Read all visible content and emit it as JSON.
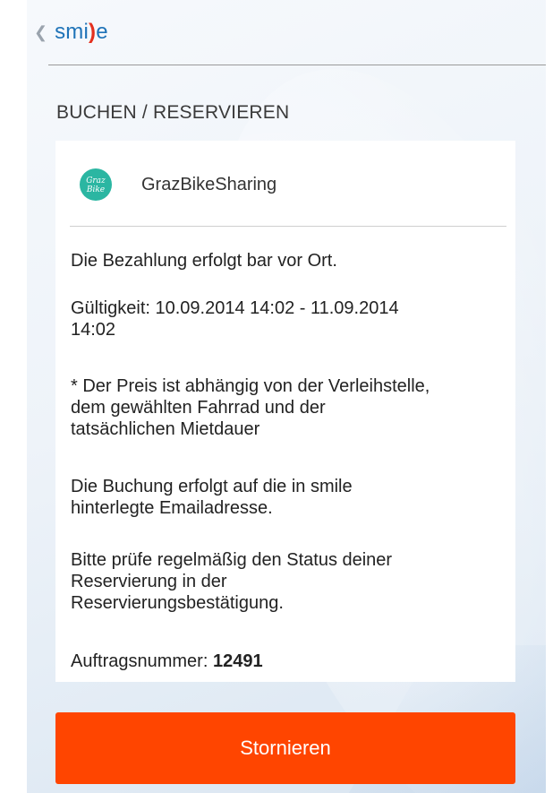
{
  "header": {
    "back_chevron": "❮",
    "logo_part1": "smi",
    "logo_part2": ")",
    "logo_part3": "e"
  },
  "section": {
    "title": "BUCHEN / RESERVIEREN"
  },
  "provider": {
    "name": "GrazBikeSharing",
    "logo_text_line1": "Graz",
    "logo_text_line2": "Bike"
  },
  "info": {
    "payment": "Die Bezahlung erfolgt bar vor Ort.",
    "validity_line1": "Gültigkeit: 10.09.2014 14:02 - 11.09.2014",
    "validity_line2": "14:02",
    "price_line1": "* Der Preis ist abhängig von der Verleihstelle,",
    "price_line2": "dem gewählten Fahrrad und der",
    "price_line3": "tatsächlichen Mietdauer",
    "booking_line1": "Die Buchung erfolgt auf die in smile",
    "booking_line2": "hinterlegte Emailadresse.",
    "check_line1": "Bitte prüfe regelmäßig den Status deiner",
    "check_line2": "Reservierung in der",
    "check_line3": "Reservierungsbestätigung.",
    "order_label": "Auftragsnummer: ",
    "order_number": "12491"
  },
  "actions": {
    "cancel_label": "Stornieren"
  },
  "colors": {
    "accent_button": "#ff4500",
    "logo_blue": "#1f73b8",
    "logo_red": "#e4301e",
    "provider_logo": "#2bb6a2"
  },
  "icons": {
    "back": "chevron-left-icon",
    "provider_logo": "grazbike-logo"
  }
}
